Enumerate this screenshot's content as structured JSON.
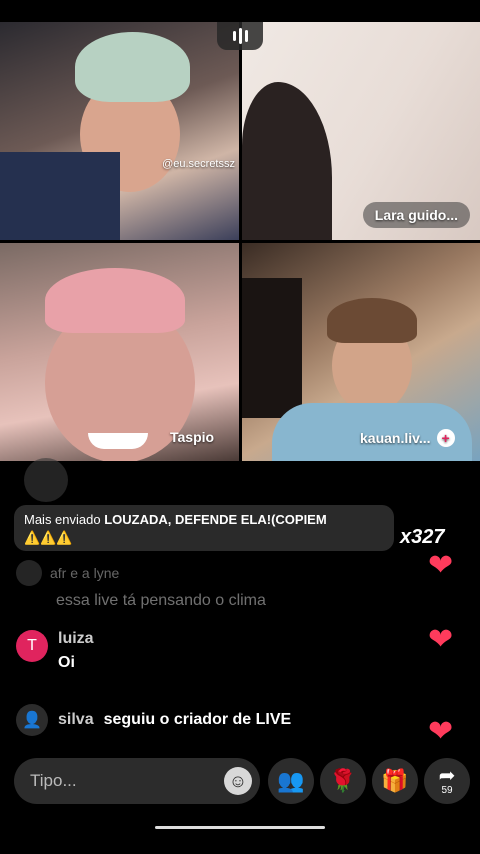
{
  "tiles": [
    {
      "label": "@eu.secretssz"
    },
    {
      "label": "Lara guido..."
    },
    {
      "label": "Taspio"
    },
    {
      "label": "kauan.liv..."
    }
  ],
  "banner": {
    "prefix": "Mais enviado",
    "message": "LOUZADA, DEFENDE ELA!(COPIEM",
    "emoji": "⚠️⚠️⚠️"
  },
  "gift_count": "x327",
  "comments": [
    {
      "user": "afr e a lyne",
      "text": "essa live tá pensando o clima"
    },
    {
      "user": "luiza",
      "avatar_letter": "T",
      "text": "Oi"
    },
    {
      "user": "silva",
      "text": "seguiu o criador de LIVE"
    }
  ],
  "input": {
    "placeholder": "Tipo..."
  },
  "share_count": "59",
  "colors": {
    "heart": "#ff3b5c",
    "avatar_luiza": "#e0245e"
  }
}
